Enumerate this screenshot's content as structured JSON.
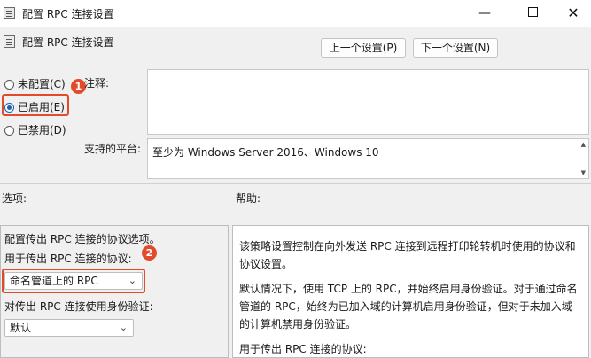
{
  "window": {
    "title": "配置 RPC 连接设置",
    "min_glyph": "—",
    "close_glyph": "✕"
  },
  "header": {
    "title": "配置 RPC 连接设置",
    "prev_button": "上一个设置(P)",
    "next_button": "下一个设置(N)"
  },
  "state": {
    "options": [
      {
        "label": "未配置(C)",
        "checked": false
      },
      {
        "label": "已启用(E)",
        "checked": true
      },
      {
        "label": "已禁用(D)",
        "checked": false
      }
    ]
  },
  "fields": {
    "comment_label": "注释:",
    "comment_value": "",
    "platform_label": "支持的平台:",
    "platform_value": "至少为 Windows Server 2016、Windows 10"
  },
  "options_section": {
    "label": "选项:",
    "line1": "配置传出 RPC 连接的协议选项。",
    "protocol_label": "用于传出 RPC 连接的协议:",
    "protocol_value": "命名管道上的 RPC",
    "auth_label": "对传出 RPC 连接使用身份验证:",
    "auth_value": "默认"
  },
  "help_section": {
    "label": "帮助:",
    "p1": "该策略设置控制在向外发送 RPC 连接到远程打印轮转机时使用的协议和协议设置。",
    "p2": "默认情况下，使用 TCP 上的 RPC，并始终启用身份验证。对于通过命名管道的 RPC，始终为已加入域的计算机启用身份验证，但对于未加入域的计算机禁用身份验证。",
    "p3": "用于传出 RPC 连接的协议:"
  },
  "annotations": {
    "badge1": "1",
    "badge2": "2",
    "highlight_color": "#e24a2a"
  }
}
